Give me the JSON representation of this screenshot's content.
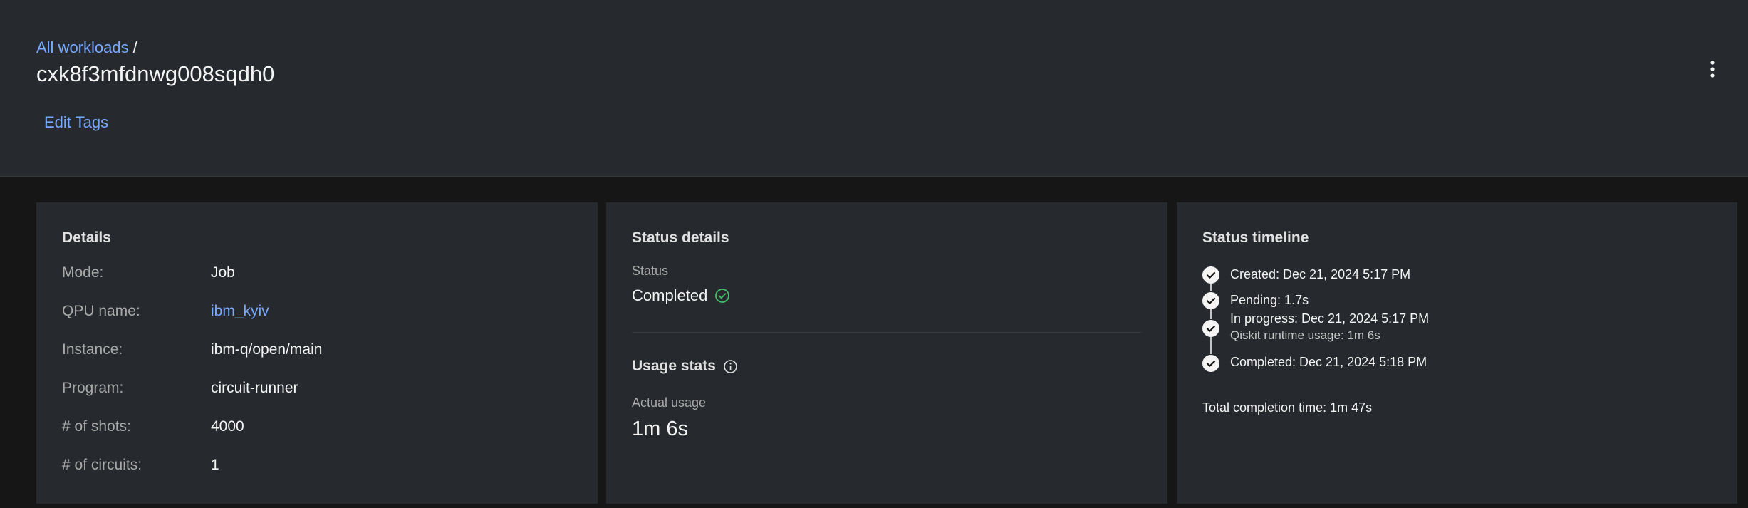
{
  "header": {
    "breadcrumb_link": "All workloads",
    "breadcrumb_separator": "/",
    "title": "cxk8f3mfdnwg008sqdh0",
    "edit_tags_label": "Edit Tags",
    "overflow_icon": "overflow-menu-vertical-icon"
  },
  "details": {
    "heading": "Details",
    "rows": [
      {
        "label": "Mode:",
        "value": "Job"
      },
      {
        "label": "QPU name:",
        "value": "ibm_kyiv"
      },
      {
        "label": "Instance:",
        "value": "ibm-q/open/main"
      },
      {
        "label": "Program:",
        "value": "circuit-runner"
      },
      {
        "label": "# of shots:",
        "value": "4000"
      },
      {
        "label": "# of circuits:",
        "value": "1"
      }
    ]
  },
  "status_details": {
    "heading": "Status details",
    "status_label": "Status",
    "status_value": "Completed",
    "status_icon": "checkmark-outline-icon",
    "status_color": "#42be65",
    "usage_heading": "Usage stats",
    "usage_info_icon": "information-icon",
    "actual_usage_label": "Actual usage",
    "actual_usage_value": "1m 6s"
  },
  "timeline": {
    "heading": "Status timeline",
    "steps": [
      {
        "text": "Created: Dec 21, 2024 5:17 PM"
      },
      {
        "text": "Pending: 1.7s"
      },
      {
        "text": "In progress: Dec 21, 2024 5:17 PM",
        "sub": "Qiskit runtime usage: 1m 6s"
      },
      {
        "text": "Completed: Dec 21, 2024 5:18 PM"
      }
    ],
    "step_icon": "checkmark-filled-icon",
    "total": "Total completion time: 1m 47s"
  },
  "colors": {
    "link": "#78a9ff",
    "background": "#161616",
    "card": "#262a2e"
  }
}
